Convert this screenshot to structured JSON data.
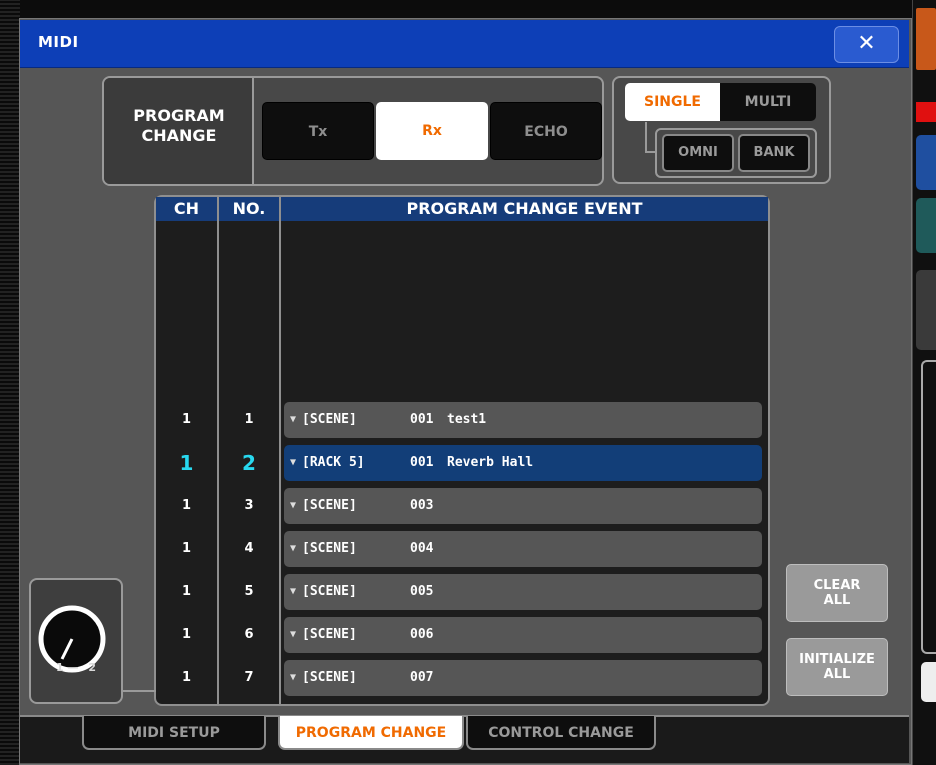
{
  "window": {
    "title": "MIDI",
    "close_glyph": "✕"
  },
  "program_change": {
    "label_line1": "PROGRAM",
    "label_line2": "CHANGE",
    "modes": [
      {
        "label": "Tx",
        "active": false
      },
      {
        "label": "Rx",
        "active": true
      },
      {
        "label": "ECHO",
        "active": false
      }
    ]
  },
  "mode_select": {
    "single": "SINGLE",
    "multi": "MULTI",
    "omni": "OMNI",
    "bank": "BANK",
    "selected": "SINGLE"
  },
  "table": {
    "headers": {
      "ch": "CH",
      "no": "NO.",
      "event": "PROGRAM CHANGE EVENT"
    },
    "rows": [
      {
        "ch": "1",
        "no": "1",
        "type": "[SCENE]",
        "num": "001",
        "name": "test1",
        "selected": false
      },
      {
        "ch": "1",
        "no": "2",
        "type": "[RACK 5]",
        "num": "001",
        "name": "Reverb Hall",
        "selected": true
      },
      {
        "ch": "1",
        "no": "3",
        "type": "[SCENE]",
        "num": "003",
        "name": "",
        "selected": false
      },
      {
        "ch": "1",
        "no": "4",
        "type": "[SCENE]",
        "num": "004",
        "name": "",
        "selected": false
      },
      {
        "ch": "1",
        "no": "5",
        "type": "[SCENE]",
        "num": "005",
        "name": "",
        "selected": false
      },
      {
        "ch": "1",
        "no": "6",
        "type": "[SCENE]",
        "num": "006",
        "name": "",
        "selected": false
      },
      {
        "ch": "1",
        "no": "7",
        "type": "[SCENE]",
        "num": "007",
        "name": "",
        "selected": false
      }
    ]
  },
  "buttons": {
    "clear_line1": "CLEAR",
    "clear_line2": "ALL",
    "init_line1": "INITIALIZE",
    "init_line2": "ALL"
  },
  "knob": {
    "min_label": "1",
    "max_label": "2",
    "separator": "—"
  },
  "tabs": [
    {
      "label": "MIDI SETUP",
      "active": false
    },
    {
      "label": "PROGRAM CHANGE",
      "active": true
    },
    {
      "label": "CONTROL CHANGE",
      "active": false
    }
  ],
  "colors": {
    "title_blue": "#0d3fb7",
    "header_blue": "#163c7a",
    "selected_row": "#123e78",
    "accent_orange": "#f06a00",
    "selected_text_cyan": "#28d8ef"
  },
  "icons": {
    "close": "close-icon",
    "row_dropdown": "triangle-down-icon",
    "knob": "knob-icon"
  }
}
